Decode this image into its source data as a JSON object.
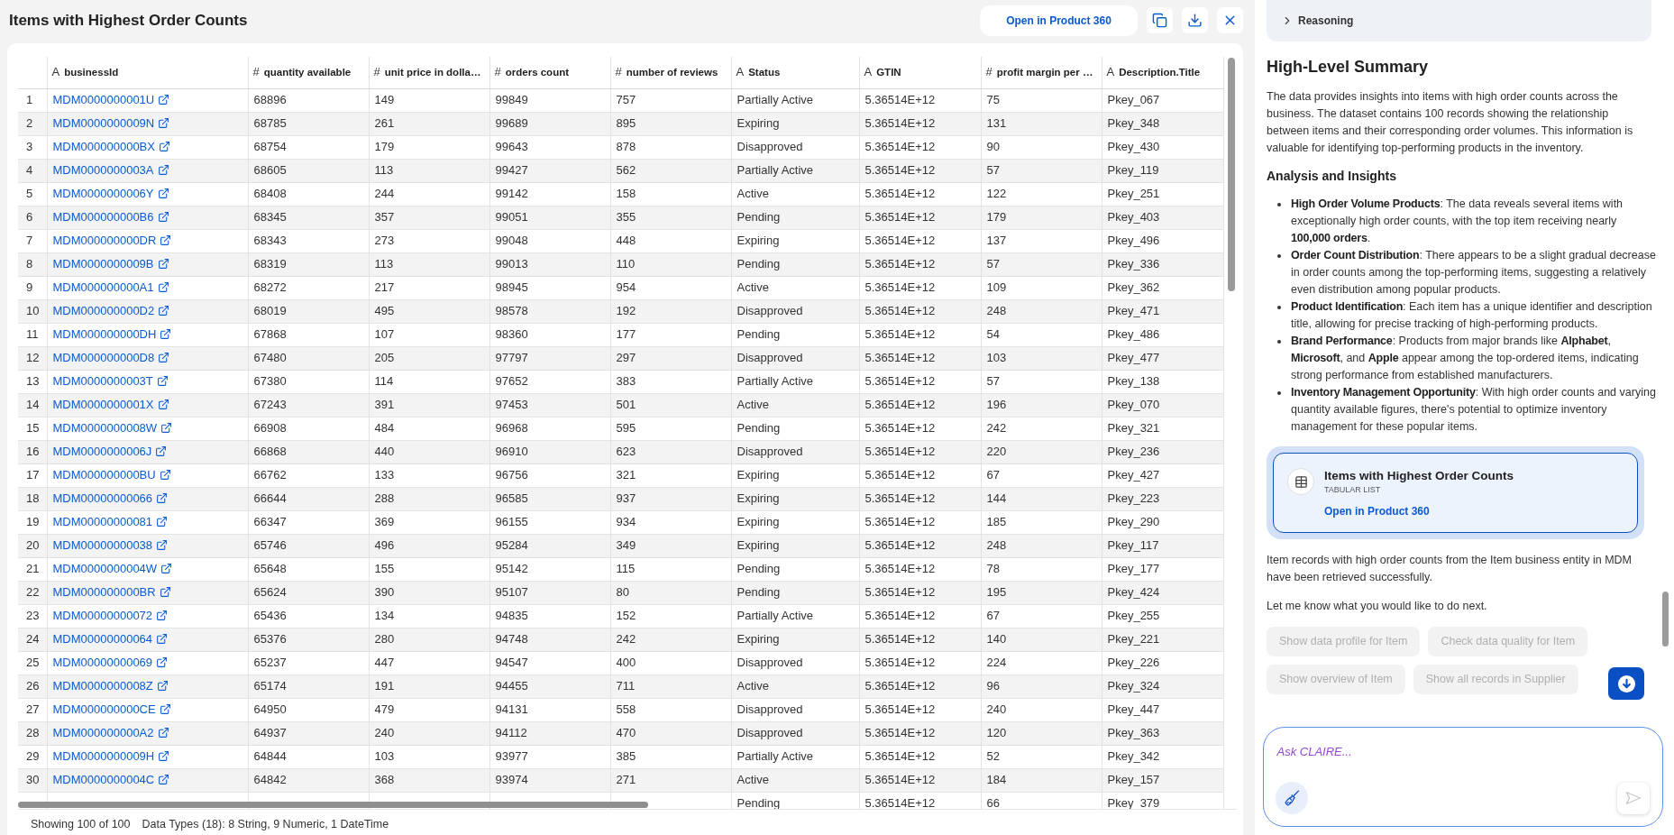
{
  "table_panel": {
    "title": "Items with Highest Order Counts",
    "open_button": "Open in Product 360",
    "columns": [
      {
        "symbol": "A",
        "label": "businessId",
        "kind": "link"
      },
      {
        "symbol": "#",
        "label": "quantity available",
        "kind": "text"
      },
      {
        "symbol": "#",
        "label": "unit price in dolla…",
        "kind": "text"
      },
      {
        "symbol": "#",
        "label": "orders count",
        "kind": "text"
      },
      {
        "symbol": "#",
        "label": "number of reviews",
        "kind": "text"
      },
      {
        "symbol": "A",
        "label": "Status",
        "kind": "text"
      },
      {
        "symbol": "A",
        "label": "GTIN",
        "kind": "text"
      },
      {
        "symbol": "#",
        "label": "profit margin per …",
        "kind": "text"
      },
      {
        "symbol": "A",
        "label": "Description.Title",
        "kind": "text"
      }
    ],
    "rows": [
      {
        "number": "1",
        "cells": [
          "MDM0000000001U",
          "68896",
          "149",
          "99849",
          "757",
          "Partially Active",
          "5.36514E+12",
          "75",
          "Pkey_067"
        ]
      },
      {
        "number": "2",
        "cells": [
          "MDM0000000009N",
          "68785",
          "261",
          "99689",
          "895",
          "Expiring",
          "5.36514E+12",
          "131",
          "Pkey_348"
        ]
      },
      {
        "number": "3",
        "cells": [
          "MDM000000000BX",
          "68754",
          "179",
          "99643",
          "878",
          "Disapproved",
          "5.36514E+12",
          "90",
          "Pkey_430"
        ]
      },
      {
        "number": "4",
        "cells": [
          "MDM0000000003A",
          "68605",
          "113",
          "99427",
          "562",
          "Partially Active",
          "5.36514E+12",
          "57",
          "Pkey_119"
        ]
      },
      {
        "number": "5",
        "cells": [
          "MDM0000000006Y",
          "68408",
          "244",
          "99142",
          "158",
          "Active",
          "5.36514E+12",
          "122",
          "Pkey_251"
        ]
      },
      {
        "number": "6",
        "cells": [
          "MDM000000000B6",
          "68345",
          "357",
          "99051",
          "355",
          "Pending",
          "5.36514E+12",
          "179",
          "Pkey_403"
        ]
      },
      {
        "number": "7",
        "cells": [
          "MDM000000000DR",
          "68343",
          "273",
          "99048",
          "448",
          "Expiring",
          "5.36514E+12",
          "137",
          "Pkey_496"
        ]
      },
      {
        "number": "8",
        "cells": [
          "MDM0000000009B",
          "68319",
          "113",
          "99013",
          "110",
          "Pending",
          "5.36514E+12",
          "57",
          "Pkey_336"
        ]
      },
      {
        "number": "9",
        "cells": [
          "MDM000000000A1",
          "68272",
          "217",
          "98945",
          "954",
          "Active",
          "5.36514E+12",
          "109",
          "Pkey_362"
        ]
      },
      {
        "number": "10",
        "cells": [
          "MDM000000000D2",
          "68019",
          "495",
          "98578",
          "192",
          "Disapproved",
          "5.36514E+12",
          "248",
          "Pkey_471"
        ]
      },
      {
        "number": "11",
        "cells": [
          "MDM000000000DH",
          "67868",
          "107",
          "98360",
          "177",
          "Pending",
          "5.36514E+12",
          "54",
          "Pkey_486"
        ]
      },
      {
        "number": "12",
        "cells": [
          "MDM000000000D8",
          "67480",
          "205",
          "97797",
          "297",
          "Disapproved",
          "5.36514E+12",
          "103",
          "Pkey_477"
        ]
      },
      {
        "number": "13",
        "cells": [
          "MDM0000000003T",
          "67380",
          "114",
          "97652",
          "383",
          "Partially Active",
          "5.36514E+12",
          "57",
          "Pkey_138"
        ]
      },
      {
        "number": "14",
        "cells": [
          "MDM0000000001X",
          "67243",
          "391",
          "97453",
          "501",
          "Active",
          "5.36514E+12",
          "196",
          "Pkey_070"
        ]
      },
      {
        "number": "15",
        "cells": [
          "MDM0000000008W",
          "66908",
          "484",
          "96968",
          "595",
          "Pending",
          "5.36514E+12",
          "242",
          "Pkey_321"
        ]
      },
      {
        "number": "16",
        "cells": [
          "MDM0000000006J",
          "66868",
          "440",
          "96910",
          "623",
          "Disapproved",
          "5.36514E+12",
          "220",
          "Pkey_236"
        ]
      },
      {
        "number": "17",
        "cells": [
          "MDM000000000BU",
          "66762",
          "133",
          "96756",
          "321",
          "Expiring",
          "5.36514E+12",
          "67",
          "Pkey_427"
        ]
      },
      {
        "number": "18",
        "cells": [
          "MDM00000000066",
          "66644",
          "288",
          "96585",
          "937",
          "Expiring",
          "5.36514E+12",
          "144",
          "Pkey_223"
        ]
      },
      {
        "number": "19",
        "cells": [
          "MDM00000000081",
          "66347",
          "369",
          "96155",
          "934",
          "Expiring",
          "5.36514E+12",
          "185",
          "Pkey_290"
        ]
      },
      {
        "number": "20",
        "cells": [
          "MDM00000000038",
          "65746",
          "496",
          "95284",
          "349",
          "Expiring",
          "5.36514E+12",
          "248",
          "Pkey_117"
        ]
      },
      {
        "number": "21",
        "cells": [
          "MDM0000000004W",
          "65648",
          "155",
          "95142",
          "115",
          "Pending",
          "5.36514E+12",
          "78",
          "Pkey_177"
        ]
      },
      {
        "number": "22",
        "cells": [
          "MDM000000000BR",
          "65624",
          "390",
          "95107",
          "80",
          "Pending",
          "5.36514E+12",
          "195",
          "Pkey_424"
        ]
      },
      {
        "number": "23",
        "cells": [
          "MDM00000000072",
          "65436",
          "134",
          "94835",
          "152",
          "Partially Active",
          "5.36514E+12",
          "67",
          "Pkey_255"
        ]
      },
      {
        "number": "24",
        "cells": [
          "MDM00000000064",
          "65376",
          "280",
          "94748",
          "242",
          "Expiring",
          "5.36514E+12",
          "140",
          "Pkey_221"
        ]
      },
      {
        "number": "25",
        "cells": [
          "MDM00000000069",
          "65237",
          "447",
          "94547",
          "400",
          "Disapproved",
          "5.36514E+12",
          "224",
          "Pkey_226"
        ]
      },
      {
        "number": "26",
        "cells": [
          "MDM0000000008Z",
          "65174",
          "191",
          "94455",
          "711",
          "Active",
          "5.36514E+12",
          "96",
          "Pkey_324"
        ]
      },
      {
        "number": "27",
        "cells": [
          "MDM000000000CE",
          "64950",
          "479",
          "94131",
          "558",
          "Disapproved",
          "5.36514E+12",
          "240",
          "Pkey_447"
        ]
      },
      {
        "number": "28",
        "cells": [
          "MDM000000000A2",
          "64937",
          "240",
          "94112",
          "470",
          "Disapproved",
          "5.36514E+12",
          "120",
          "Pkey_363"
        ]
      },
      {
        "number": "29",
        "cells": [
          "MDM0000000009H",
          "64844",
          "103",
          "93977",
          "385",
          "Partially Active",
          "5.36514E+12",
          "52",
          "Pkey_342"
        ]
      },
      {
        "number": "30",
        "cells": [
          "MDM0000000004C",
          "64842",
          "368",
          "93974",
          "271",
          "Active",
          "5.36514E+12",
          "184",
          "Pkey_157"
        ]
      },
      {
        "cells": [
          null,
          null,
          null,
          null,
          null,
          "Pending",
          "5.36514E+12",
          "66",
          "Pkey_379"
        ]
      }
    ],
    "status_bar": {
      "count": "Showing 100 of 100",
      "data_types": "Data Types (18): 8 String, 9 Numeric, 1 DateTime"
    }
  },
  "assistant_panel": {
    "reasoning": {
      "label": "Reasoning",
      "expanded": false
    },
    "summary_heading": "High-Level Summary",
    "summary": "The data provides insights into items with high order counts across the business. The dataset contains 100 records showing the relationship between items and their corresponding order volumes. This information is valuable for identifying top-performing products in the inventory.",
    "insights_heading": "Analysis and Insights",
    "insights": [
      "**High Order Volume Products**: The data reveals several items with exceptionally high order counts, with the top item receiving nearly **100,000 orders**.",
      "**Order Count Distribution**: There appears to be a slight gradual decrease in order counts among the top-performing items, suggesting a relatively even distribution among popular products.",
      "**Product Identification**: Each item has a unique identifier and description title, allowing for precise tracking of high-performing products.",
      "**Brand Performance**: Products from major brands like **Alphabet**, **Microsoft**, and **Apple** appear among the top-ordered items, indicating strong performance from established manufacturers.",
      "**Inventory Management Opportunity**: With high order counts and varying quantity available figures, there's potential to optimize inventory management for these popular items."
    ],
    "result_card": {
      "title": "Items with Highest Order Counts",
      "type": "TABULAR LIST",
      "link": "Open in Product 360"
    },
    "messages": [
      "Item records with high order counts from the Item business entity in MDM have been retrieved successfully.",
      "Let me know what you would like to do next."
    ],
    "suggestions": [
      {
        "label": "Show data profile for Item",
        "disabled": true
      },
      {
        "label": "Check data quality for Item",
        "disabled": true
      },
      {
        "label": "Show overview of Item",
        "disabled": true
      },
      {
        "label": "Show all records in Supplier",
        "disabled": true
      }
    ],
    "input": {
      "placeholder": "Ask CLAIRE..."
    }
  }
}
